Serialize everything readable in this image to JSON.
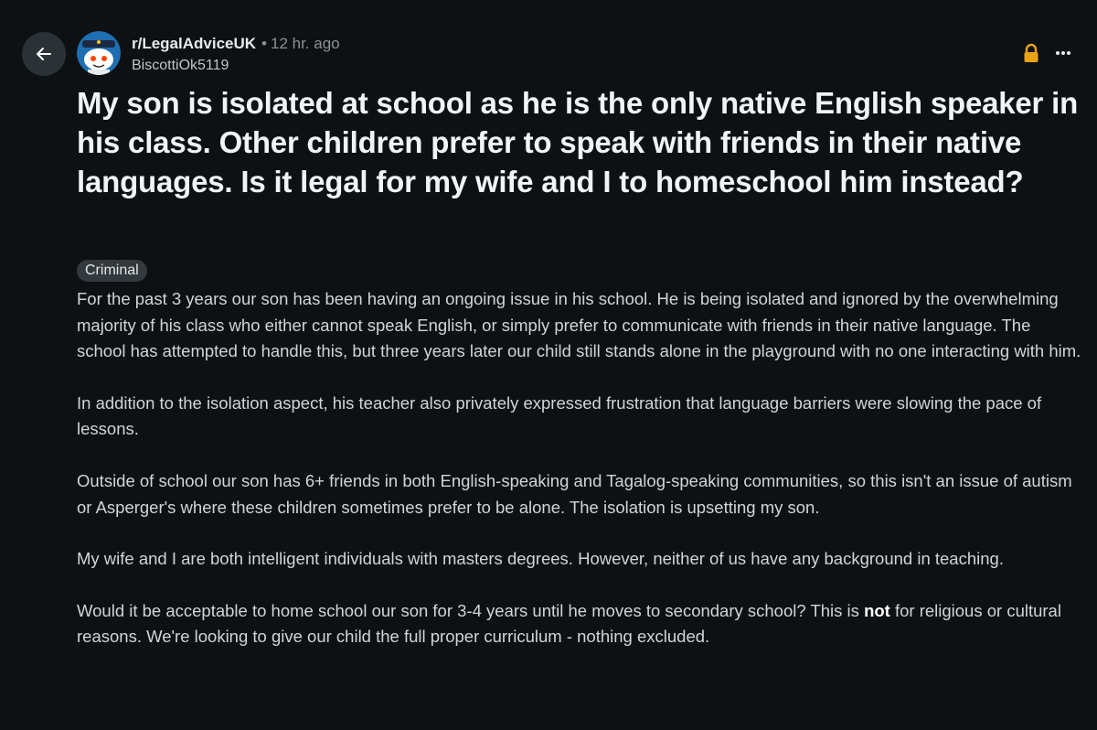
{
  "post": {
    "subreddit": "r/LegalAdviceUK",
    "separator": "•",
    "time": "12 hr. ago",
    "author": "BiscottiOk5119",
    "title": "My son is isolated at school as he is the only native English speaker in his class. Other children prefer to speak with friends in their native languages. Is it legal for my wife and I to homeschool him instead?",
    "flair": "Criminal",
    "paragraphs": [
      "For the past 3 years our son has been having an ongoing issue in his school. He is being isolated and ignored by the overwhelming majority of his class who either cannot speak English, or simply prefer to communicate with friends in their native language. The school has attempted to handle this, but three years later our child still stands alone in the playground with no one interacting with him.",
      "In addition to the isolation aspect, his teacher also privately expressed frustration that language barriers were slowing the pace of lessons.",
      "Outside of school our son has 6+ friends in both English-speaking and Tagalog-speaking communities, so this isn't an issue of autism or Asperger's where these children sometimes prefer to be alone. The isolation is upsetting my son.",
      "My wife and I are both intelligent individuals with masters degrees. However, neither of us have any background in teaching."
    ],
    "last_paragraph": {
      "before": "Would it be acceptable to home school our son for 3-4 years until he moves to secondary school? This is ",
      "bold": "not",
      "after": " for religious or cultural reasons. We're looking to give our child the full proper curriculum - nothing excluded."
    }
  },
  "icons": {
    "back": "arrow-left-icon",
    "avatar": "snoo-avatar-icon",
    "lock": "lock-icon",
    "more": "more-dots-icon"
  },
  "colors": {
    "background": "#0e1113",
    "lock": "#e8a317",
    "flair_bg": "#33393d"
  }
}
